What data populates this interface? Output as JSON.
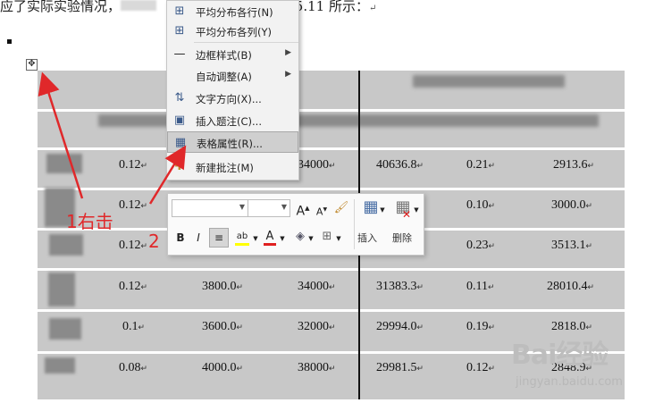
{
  "document": {
    "line_prefix": "应了实际实验情况，",
    "line_suffix": "如表 5.11 所示：",
    "return_mark": "↵"
  },
  "context_menu": {
    "items": [
      {
        "label": "平均分布各行(N)",
        "icon": "distribute-rows-icon"
      },
      {
        "label": "平均分布各列(Y)",
        "icon": "distribute-columns-icon"
      },
      {
        "label": "边框样式(B)",
        "icon": "border-style-icon",
        "submenu": true
      },
      {
        "label": "自动调整(A)",
        "icon": "",
        "submenu": true
      },
      {
        "label": "文字方向(X)...",
        "icon": "text-direction-icon"
      },
      {
        "label": "插入题注(C)...",
        "icon": "insert-caption-icon"
      },
      {
        "label": "表格属性(R)...",
        "icon": "table-properties-icon",
        "highlighted": true
      },
      {
        "label": "新建批注(M)",
        "icon": "new-comment-icon"
      }
    ]
  },
  "mini_toolbar": {
    "font_name": "",
    "font_size": "",
    "grow_font": "A",
    "shrink_font": "A",
    "bold": "B",
    "italic": "I",
    "highlight_label": "ab",
    "font_color_label": "A",
    "insert_label": "插入",
    "delete_label": "删除",
    "colors": {
      "highlight": "#ffff00",
      "font_color": "#e02020"
    }
  },
  "table": {
    "rows": [
      {
        "c1": "0.12",
        "c3": "34000",
        "c4": "40636.8",
        "c5": "0.21",
        "c6": "2913.6"
      },
      {
        "c1": "0.12",
        "c3": "",
        "c4": "",
        "c5": "0.10",
        "c6": "3000.0"
      },
      {
        "c1": "0.12",
        "c3": "",
        "c4": "",
        "c5": "0.23",
        "c6": "3513.1"
      },
      {
        "c1": "0.12",
        "c2": "3800.0",
        "c3": "34000",
        "c4": "31383.3",
        "c5": "0.11",
        "c6": "28010.4"
      },
      {
        "c1": "0.1",
        "c2": "3600.0",
        "c3": "32000",
        "c4": "29994.0",
        "c5": "0.19",
        "c6": "2818.0"
      },
      {
        "c1": "0.08",
        "c2": "4000.0",
        "c3": "38000",
        "c4": "29981.5",
        "c5": "0.12",
        "c6": "2848.9"
      }
    ]
  },
  "annotations": {
    "step1": "1右击",
    "step2": "2",
    "color": "#e0282a"
  },
  "watermark": {
    "brand": "Bai经验",
    "url": "jingyan.baidu.com"
  }
}
